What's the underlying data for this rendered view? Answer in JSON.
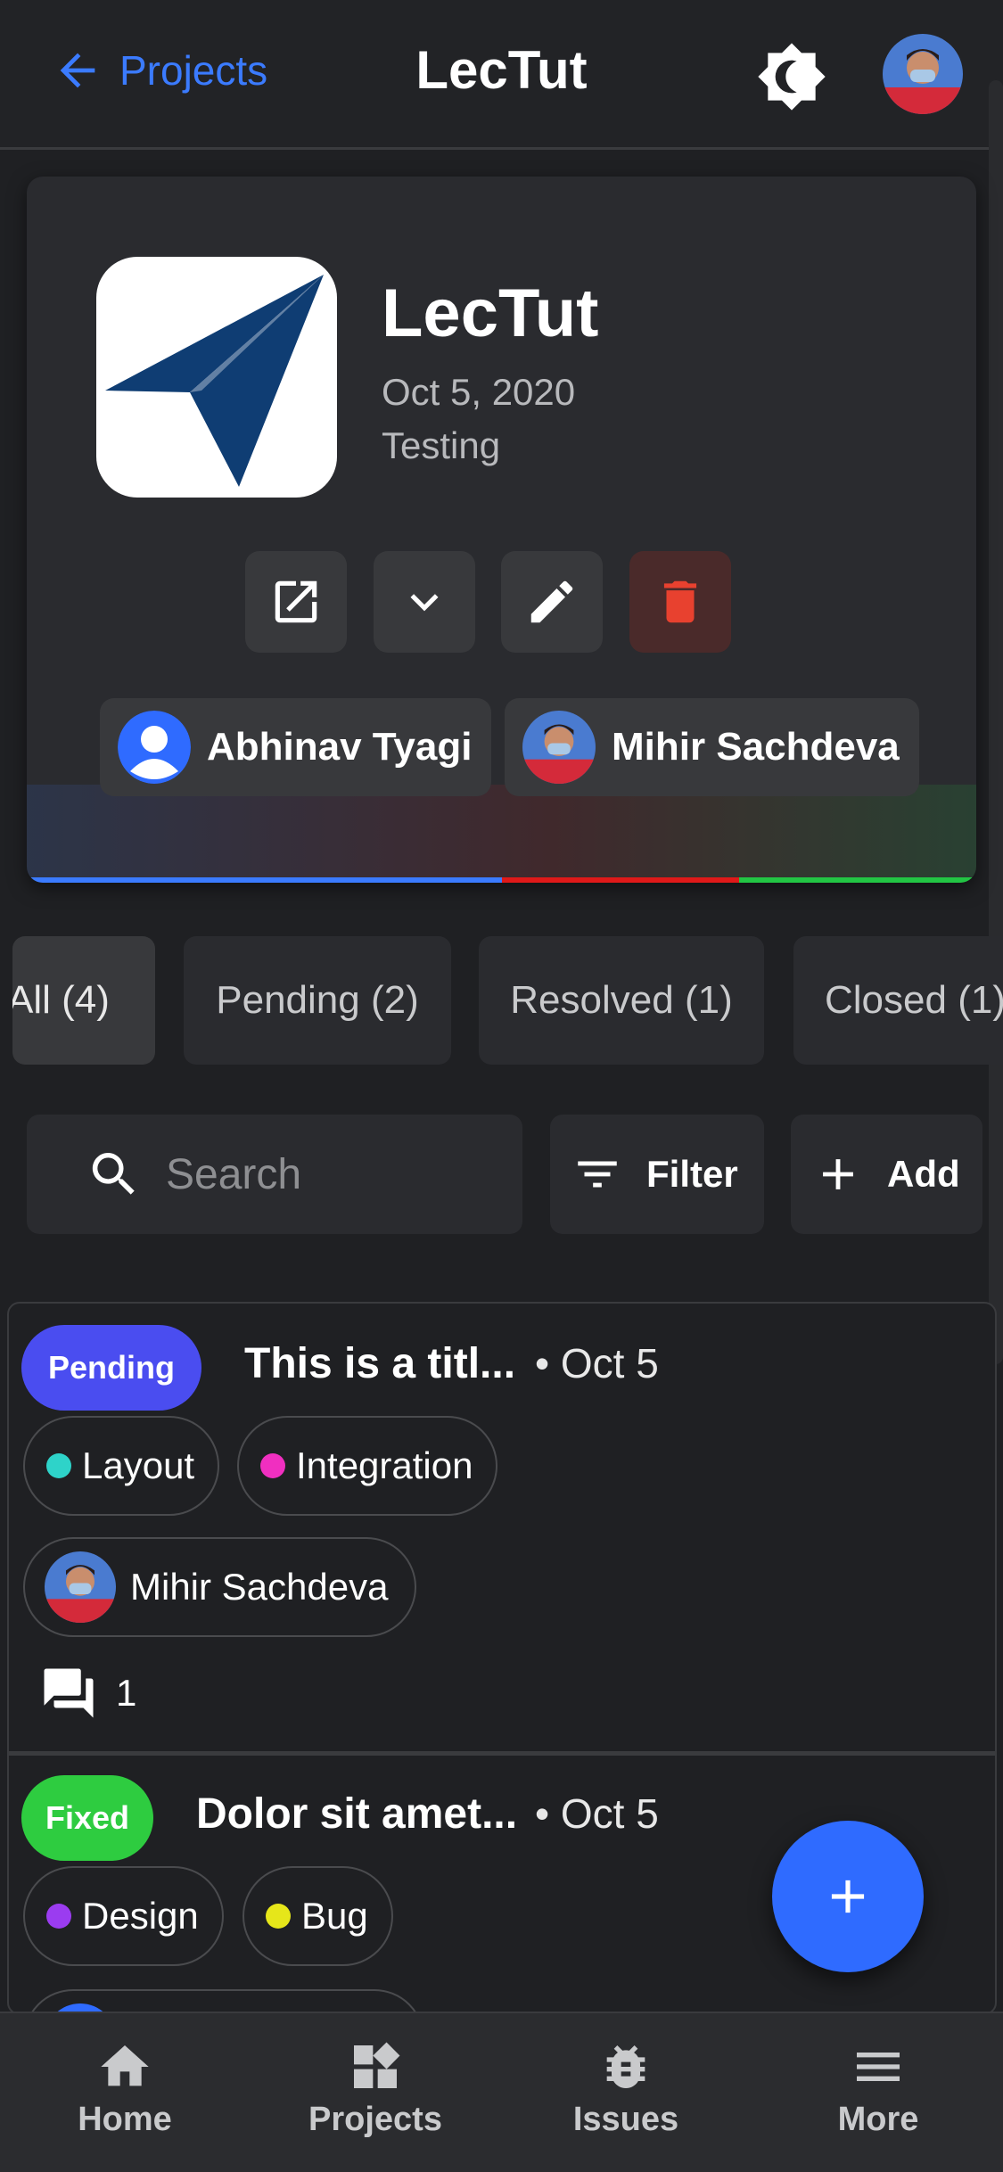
{
  "header": {
    "back_label": "Projects",
    "title": "LecTut"
  },
  "project": {
    "name": "LecTut",
    "date": "Oct 5, 2020",
    "status": "Testing",
    "members": [
      {
        "name": "Abhinav Tyagi"
      },
      {
        "name": "Mihir Sachdeva"
      }
    ],
    "progress": {
      "pending": 0.5,
      "resolved": 0.25,
      "closed": 0.25
    },
    "colors": {
      "pending": "#3b7bff",
      "resolved": "#df1919",
      "closed": "#22c544"
    }
  },
  "tabs": [
    {
      "label": "All (4)",
      "active": true
    },
    {
      "label": "Pending (2)"
    },
    {
      "label": "Resolved (1)"
    },
    {
      "label": "Closed (1)"
    }
  ],
  "toolbar": {
    "search_placeholder": "Search",
    "filter_label": "Filter",
    "add_label": "Add"
  },
  "issues": [
    {
      "status": "Pending",
      "status_color": "#4a4df0",
      "title": "This is a titl...",
      "date": "• Oct 5",
      "labels": [
        {
          "name": "Layout",
          "color": "#2ed3c9"
        },
        {
          "name": "Integration",
          "color": "#f02fc0"
        }
      ],
      "assignee": "Mihir Sachdeva",
      "comments": "1"
    },
    {
      "status": "Fixed",
      "status_color": "#2ecc40",
      "title": "Dolor sit amet...",
      "date": "• Oct 5",
      "labels": [
        {
          "name": "Design",
          "color": "#9b3cf0"
        },
        {
          "name": "Bug",
          "color": "#e6e61a"
        }
      ]
    }
  ],
  "nav": {
    "home": "Home",
    "projects": "Projects",
    "issues": "Issues",
    "more": "More"
  }
}
